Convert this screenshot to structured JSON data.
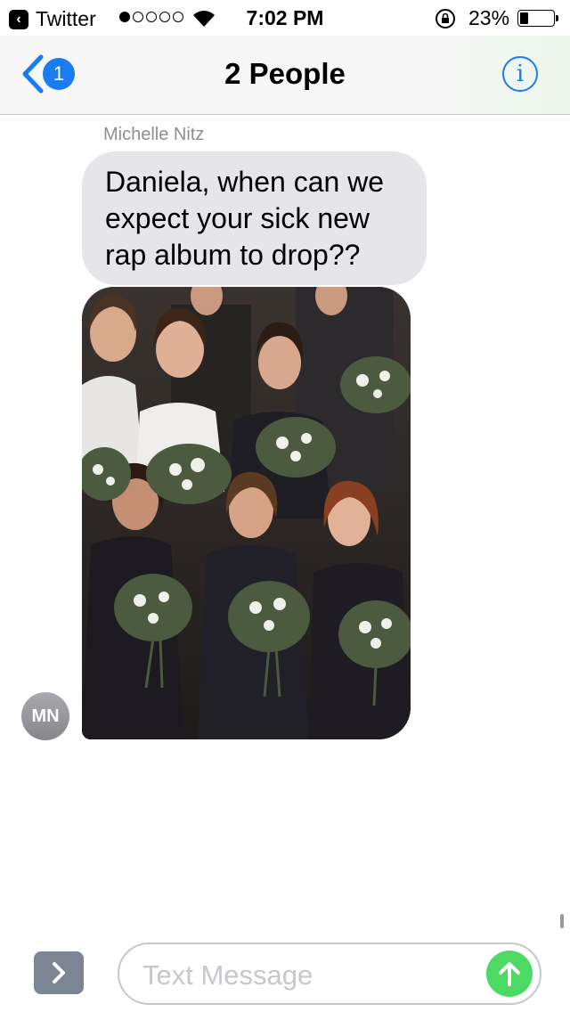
{
  "status_bar": {
    "back_app_label": "Twitter",
    "signal_bars_filled": 1,
    "signal_bars_total": 5,
    "time": "7:02 PM",
    "battery_percent": "23%",
    "battery_level": 0.23
  },
  "nav": {
    "back_badge_count": "1",
    "title": "2 People",
    "info_icon": "info-icon"
  },
  "conversation": {
    "sender_name": "Michelle Nitz",
    "message_text": "Daniela, when can we expect your sick new rap album to drop??",
    "photo_icon": "photo-attachment",
    "avatar_initials": "MN"
  },
  "composer": {
    "apps_icon": "chevron-right-icon",
    "placeholder": "Text Message",
    "value": "",
    "send_icon": "arrow-up-icon"
  },
  "colors": {
    "accent": "#1a7cf3",
    "bubble_gray": "#e5e5ea",
    "send_green": "#4cd964"
  }
}
